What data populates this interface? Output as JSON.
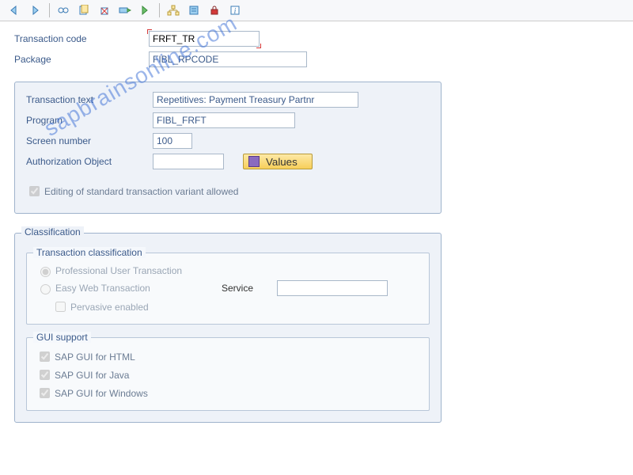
{
  "toolbar": {
    "back": "◄",
    "forward": "►"
  },
  "header": {
    "tcode_label": "Transaction code",
    "tcode_value": "FRFT_TR",
    "package_label": "Package",
    "package_value": "FIBL_RPCODE"
  },
  "details": {
    "text_label": "Transaction text",
    "text_value": "Repetitives: Payment Treasury Partnr",
    "program_label": "Program",
    "program_value": "FIBL_FRFT",
    "screen_label": "Screen number",
    "screen_value": "100",
    "authobj_label": "Authorization Object",
    "authobj_value": "",
    "values_btn": "Values",
    "edit_variant_label": "Editing of standard transaction variant allowed"
  },
  "classification": {
    "title": "Classification",
    "trans_class_title": "Transaction classification",
    "professional": "Professional User Transaction",
    "easyweb": "Easy Web Transaction",
    "service_label": "Service",
    "service_value": "",
    "pervasive": "Pervasive enabled",
    "gui_title": "GUI support",
    "gui_html": "SAP GUI for HTML",
    "gui_java": "SAP GUI for Java",
    "gui_windows": "SAP GUI for Windows"
  },
  "watermark": "sapbrainsonline.com"
}
